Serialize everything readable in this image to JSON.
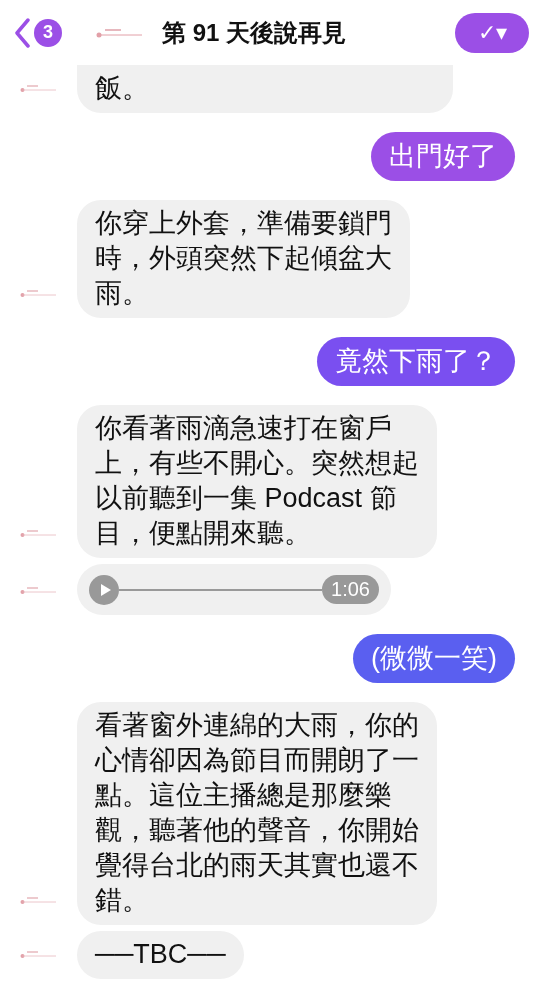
{
  "header": {
    "back_count": "3",
    "title": "第 91 天後說再見",
    "action_icon": "✓▾"
  },
  "messages": [
    {
      "kind": "received",
      "lines": [
        "飯。"
      ]
    },
    {
      "kind": "sent",
      "lines": [
        "出門好了"
      ],
      "color": "#9b4fe6"
    },
    {
      "kind": "received",
      "lines": [
        "你穿上外套，準備要鎖門",
        "時，外頭突然下起傾盆大",
        "雨。"
      ]
    },
    {
      "kind": "sent",
      "lines": [
        "竟然下雨了？"
      ],
      "color": "#7a4ff0"
    },
    {
      "kind": "received",
      "lines": [
        "你看著雨滴急速打在窗戶",
        "上，有些不開心。突然想起",
        "以前聽到一集 Podcast 節",
        "目，便點開來聽。"
      ]
    },
    {
      "kind": "audio",
      "duration": "1:06"
    },
    {
      "kind": "sent",
      "lines": [
        "(微微一笑)"
      ],
      "color": "#5a5ff0"
    },
    {
      "kind": "received",
      "lines": [
        "看著窗外連綿的大雨，你的",
        "心情卻因為節目而開朗了一",
        "點。這位主播總是那麼樂",
        "觀，聽著他的聲音，你開始",
        "覺得台北的雨天其實也還不",
        "錯。"
      ]
    },
    {
      "kind": "received",
      "lines": [
        "──TBC──"
      ]
    }
  ]
}
